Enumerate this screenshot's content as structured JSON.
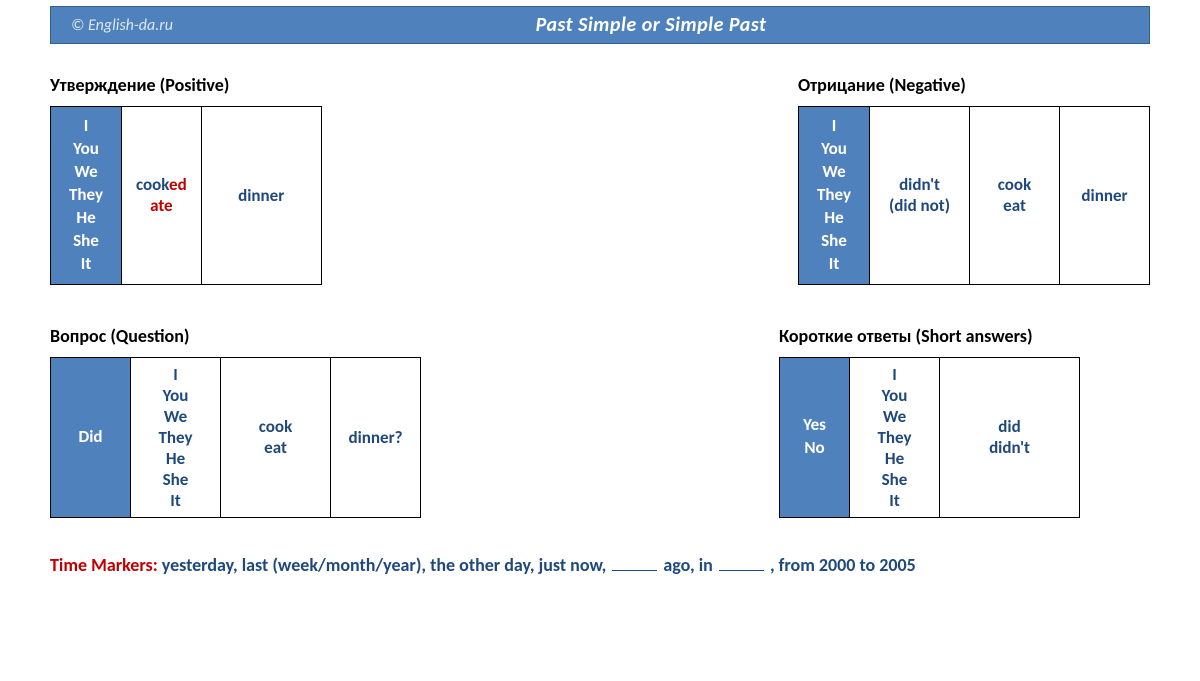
{
  "header": {
    "source": "© English-da.ru",
    "title": "Past Simple or Simple Past"
  },
  "sections": {
    "positive": {
      "title": "Утверждение (Positive)",
      "pronouns": "I\nYou\nWe\nThey\nHe\nShe\nIt",
      "verb_base": "cook",
      "verb_suffix": "ed",
      "verb_irreg": "ate",
      "object": "dinner"
    },
    "negative": {
      "title": "Отрицание (Negative)",
      "pronouns": "I\nYou\nWe\nThey\nHe\nShe\nIt",
      "aux": "didn't\n(did not)",
      "verb": "cook\neat",
      "object": "dinner"
    },
    "question": {
      "title": "Вопрос (Question)",
      "aux": "Did",
      "pronouns": "I\nYou\nWe\nThey\nHe\nShe\nIt",
      "verb": "cook\neat",
      "object": "dinner?"
    },
    "short": {
      "title": "Короткие ответы (Short answers)",
      "yesno": "Yes\nNo",
      "pronouns": "I\nYou\nWe\nThey\nHe\nShe\nIt",
      "answer": "did\ndidn't"
    }
  },
  "footer": {
    "label": "Time Markers:",
    "part1": "  yesterday, last (week/month/year), the other day, just now, ",
    "part2": " ago, in ",
    "part3": " , from 2000 to 2005"
  }
}
